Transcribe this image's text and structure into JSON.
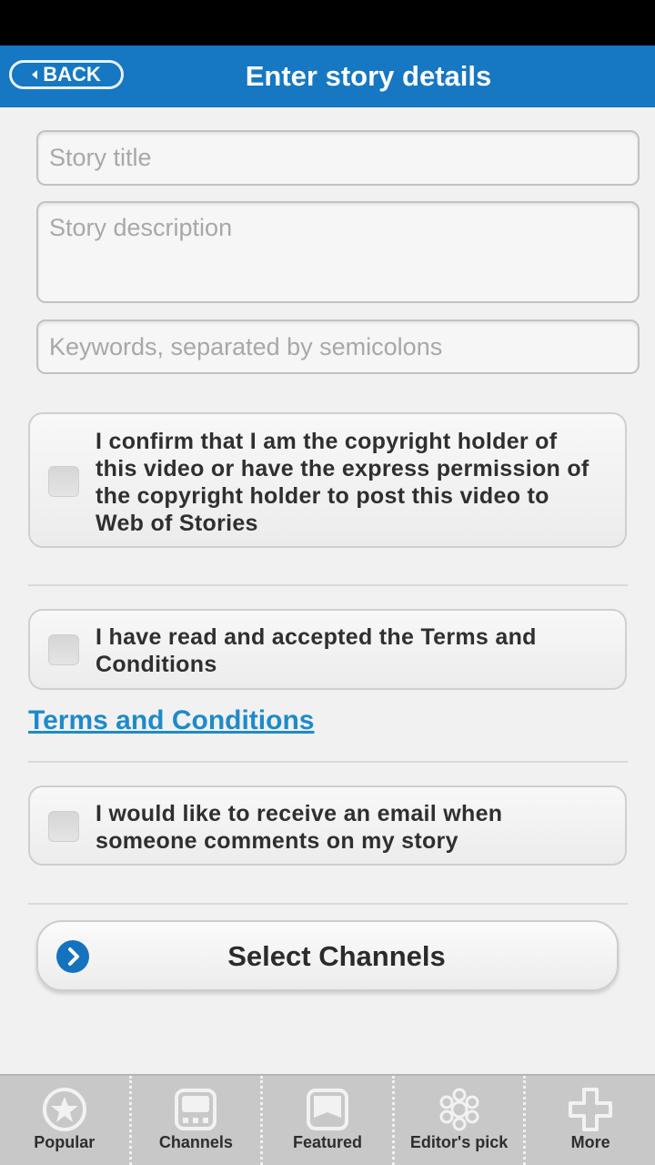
{
  "header": {
    "back_label": "BACK",
    "title": "Enter story details"
  },
  "form": {
    "title_placeholder": "Story title",
    "description_placeholder": "Story description",
    "keywords_placeholder": "Keywords, separated by semicolons"
  },
  "checkboxes": {
    "copyright": "I confirm that I am the copyright holder of this video or have the express permission of the copyright holder to post this video to Web of Stories",
    "terms": "I have read and accepted the Terms and Conditions",
    "email": "I would like to receive an email when someone comments on my story"
  },
  "terms_link": "Terms and Conditions",
  "select_channels": "Select Channels",
  "tabs": [
    {
      "label": "Popular",
      "icon": "star-icon"
    },
    {
      "label": "Channels",
      "icon": "channels-icon"
    },
    {
      "label": "Featured",
      "icon": "featured-icon"
    },
    {
      "label": "Editor's pick",
      "icon": "editors-pick-icon"
    },
    {
      "label": "More",
      "icon": "plus-icon"
    }
  ],
  "colors": {
    "header": "#1677c2",
    "link": "#1f8ac9",
    "tabbar": "#c8c8c8"
  }
}
